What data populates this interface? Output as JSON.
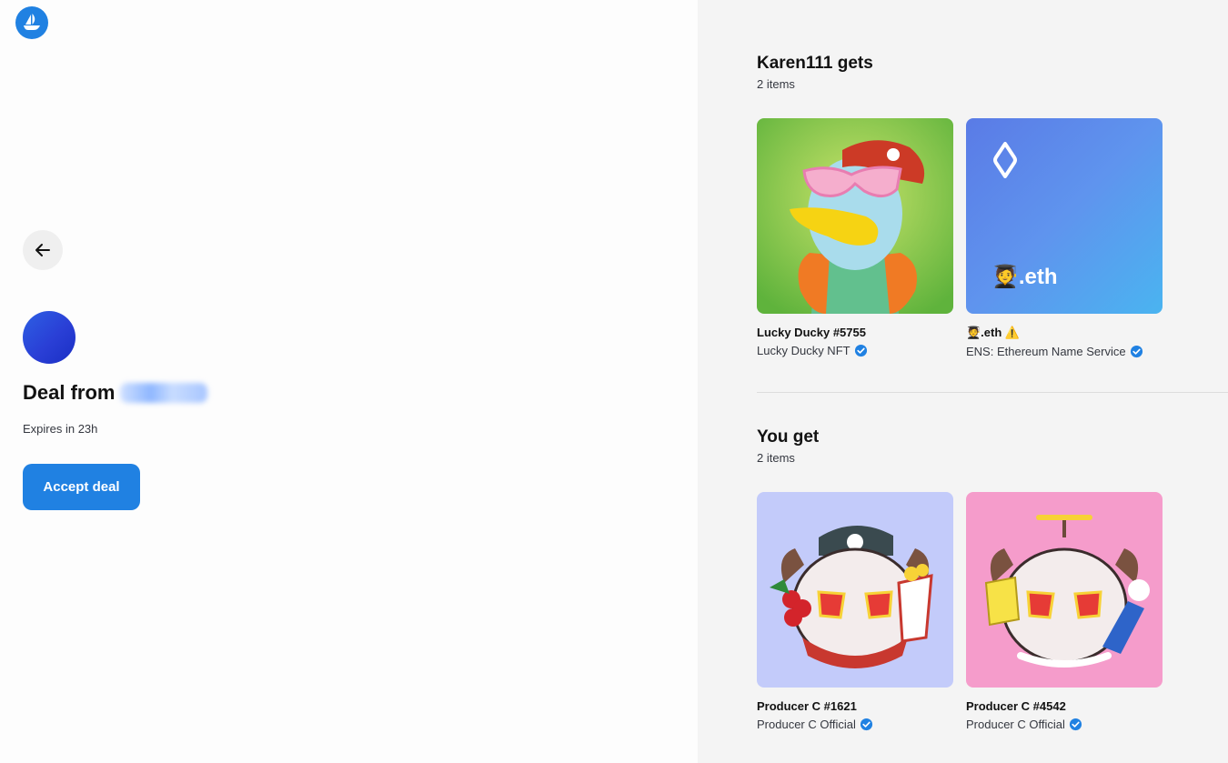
{
  "app": {
    "logo_icon": "opensea-logo",
    "accent": "#2081e2"
  },
  "deal": {
    "title_prefix": "Deal from",
    "expires": "Expires in 23h",
    "accept_label": "Accept deal"
  },
  "they_get": {
    "title": "Karen111 gets",
    "count": "2 items",
    "items": [
      {
        "name": "Lucky Ducky #5755",
        "collection": "Lucky Ducky NFT",
        "verified": true,
        "bg": "#6cbd45"
      },
      {
        "name": "🧑‍🎓.eth ⚠️",
        "collection": "ENS: Ethereum Name Service",
        "verified": true,
        "thumb_text": "🧑‍🎓.eth"
      }
    ]
  },
  "you_get": {
    "title": "You get",
    "count": "2 items",
    "items": [
      {
        "name": "Producer C #1621",
        "collection": "Producer C Official",
        "verified": true,
        "bg": "#c3cbfa"
      },
      {
        "name": "Producer C #4542",
        "collection": "Producer C Official",
        "verified": true,
        "bg": "#f59ccb"
      }
    ]
  }
}
